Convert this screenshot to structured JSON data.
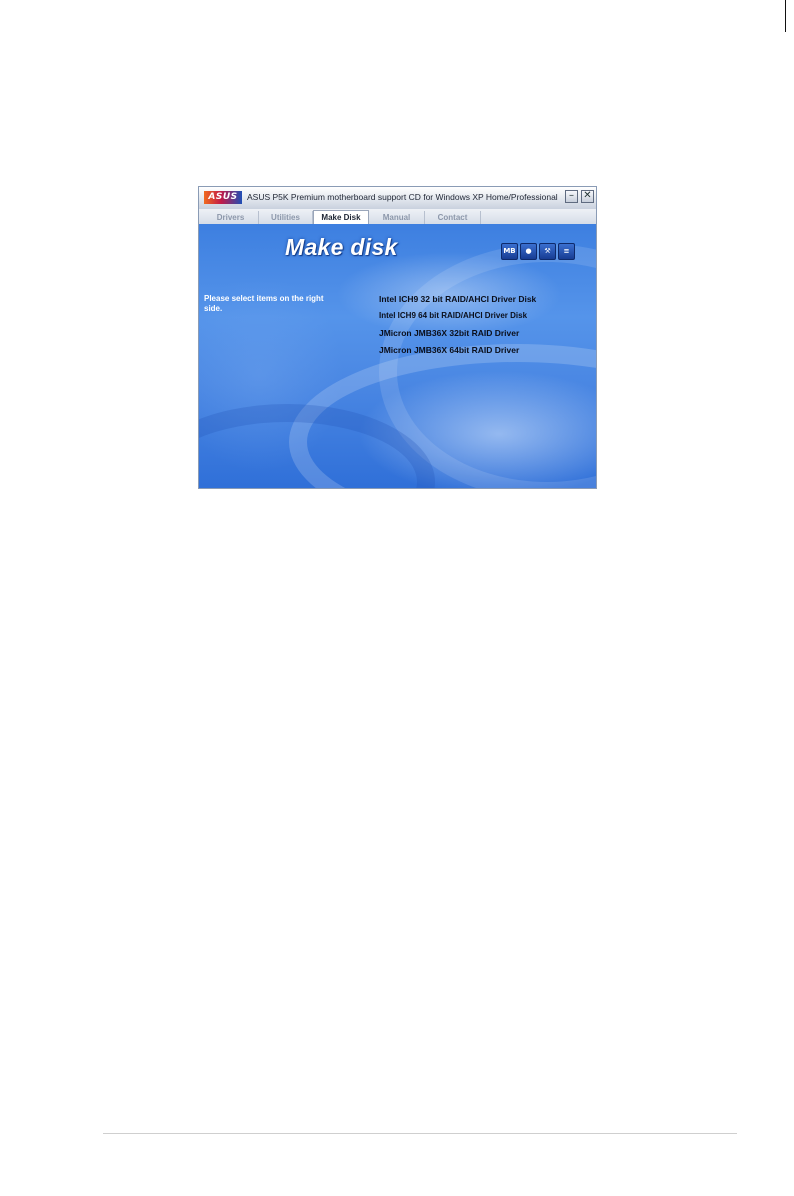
{
  "window": {
    "logo": "ASUS",
    "title": "ASUS P5K Premium motherboard support CD for Windows XP Home/Professional",
    "minimize": "–",
    "close": "✕"
  },
  "tabs": [
    {
      "label": "Drivers",
      "active": false
    },
    {
      "label": "Utilities",
      "active": false
    },
    {
      "label": "Make Disk",
      "active": true
    },
    {
      "label": "Manual",
      "active": false
    },
    {
      "label": "Contact",
      "active": false
    }
  ],
  "content": {
    "heading": "Make disk",
    "instruction": "Please select items on the right side.",
    "icons": [
      {
        "name": "motherboard-info-icon",
        "glyph": "MB"
      },
      {
        "name": "browse-cd-icon",
        "glyph": "●"
      },
      {
        "name": "tools-icon",
        "glyph": "⚒"
      },
      {
        "name": "readme-icon",
        "glyph": "≡"
      }
    ],
    "drivers": [
      "Intel ICH9 32 bit RAID/AHCI Driver Disk",
      "Intel ICH9 64 bit RAID/AHCI Driver Disk",
      "JMicron JMB36X 32bit RAID Driver",
      "JMicron JMB36X 64bit RAID Driver"
    ]
  },
  "colors": {
    "accent": "#3d7fe0",
    "heading": "#ffffff"
  }
}
